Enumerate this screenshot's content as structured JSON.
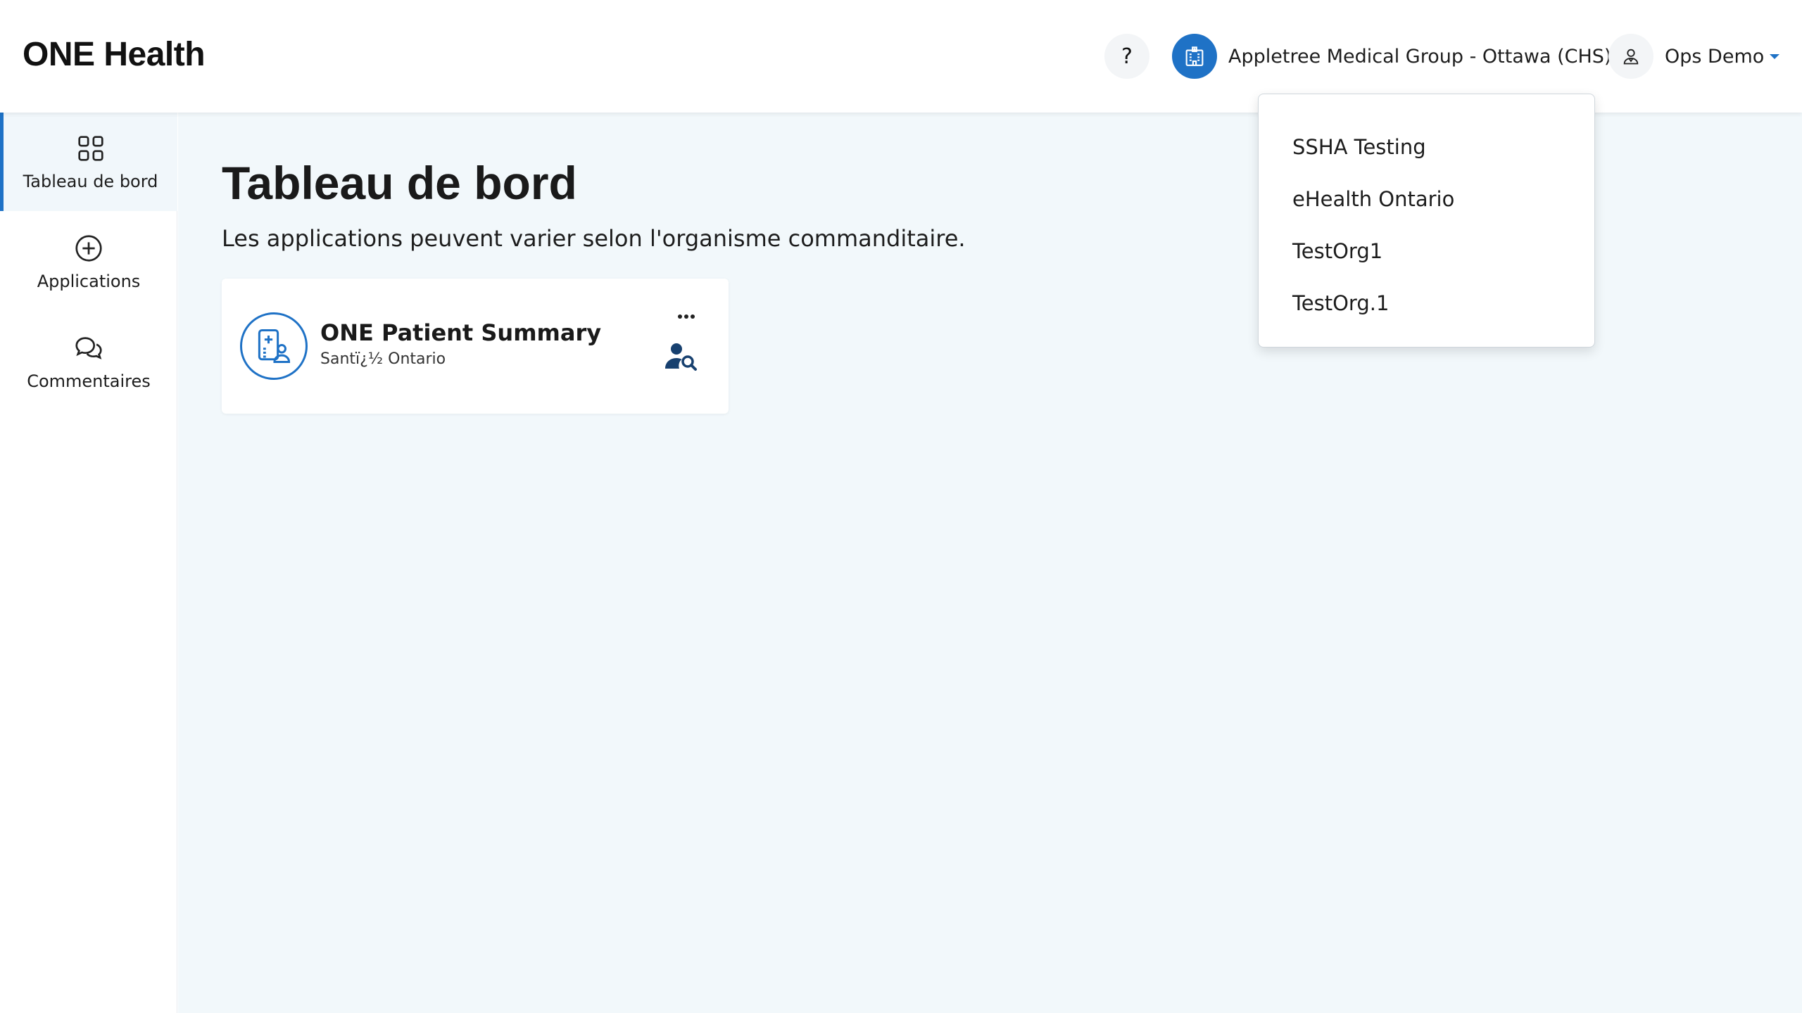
{
  "header": {
    "logo": "ONE Health",
    "help_label": "?",
    "organization": "Appletree Medical Group - Ottawa (CHS)",
    "user": "Ops Demo"
  },
  "sidebar": {
    "items": [
      {
        "label": "Tableau de bord",
        "icon": "grid-icon",
        "active": true
      },
      {
        "label": "Applications",
        "icon": "plus-circle-icon",
        "active": false
      },
      {
        "label": "Commentaires",
        "icon": "chat-bubbles-icon",
        "active": false
      }
    ]
  },
  "main": {
    "title": "Tableau de bord",
    "subtitle": "Les applications peuvent varier selon l'organisme commanditaire.",
    "app_card": {
      "name": "ONE Patient Summary",
      "organization": "Santï¿½ Ontario",
      "more_label": "•••"
    }
  },
  "org_dropdown": {
    "options": [
      "SSHA Testing",
      "eHealth Ontario",
      "TestOrg1",
      "TestOrg.1"
    ]
  },
  "colors": {
    "accent": "#1f72c6",
    "main_bg": "#f2f8fb"
  }
}
